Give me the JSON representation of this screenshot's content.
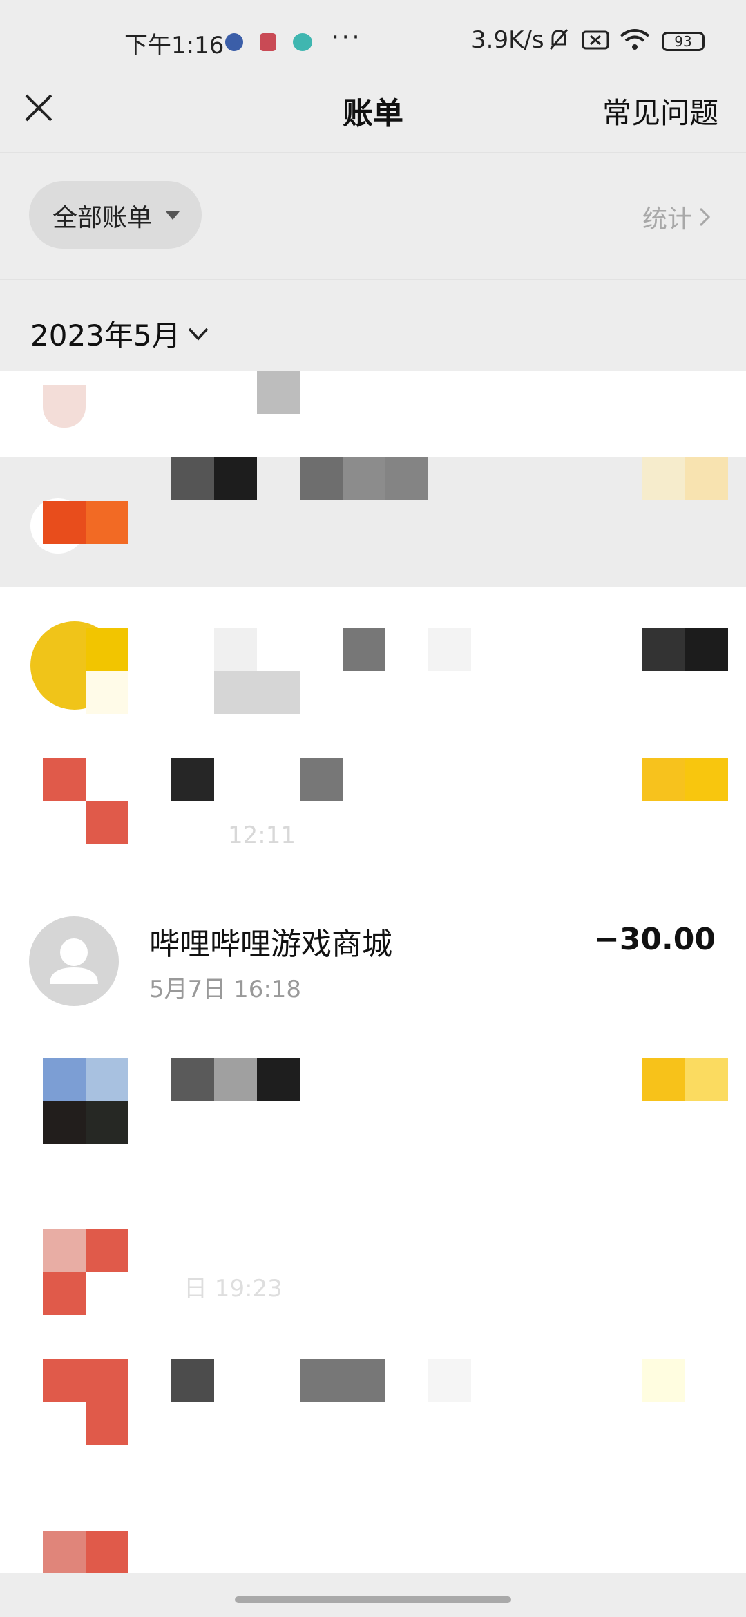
{
  "status_bar": {
    "time": "下午1:16",
    "more": "···",
    "network_speed": "3.9K/s",
    "battery": "93"
  },
  "nav": {
    "title": "账单",
    "faq": "常见问题"
  },
  "filter": {
    "label": "全部账单",
    "stats": "统计"
  },
  "month": {
    "label": "2023年5月"
  },
  "transactions": [
    {
      "merchant": "哔哩哔哩游戏商城",
      "time": "5月7日 16:18",
      "amount": "−30.00"
    }
  ],
  "partial_texts": {
    "row_time_fragment_1": "12:11",
    "row_time_fragment_2": "日 19:23"
  },
  "colors": {
    "background": "#ededed",
    "list_bg": "#ffffff",
    "accent_yellow": "#f5c518",
    "accent_red": "#e05a4a"
  }
}
